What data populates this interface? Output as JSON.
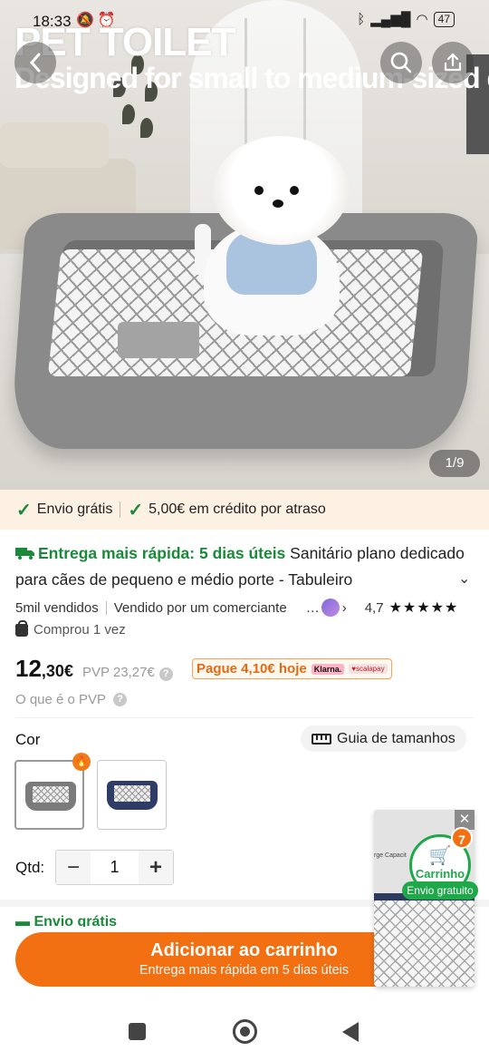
{
  "status_bar": {
    "time": "18:33",
    "battery": "47"
  },
  "hero": {
    "overlay_title": "PET TOILET",
    "overlay_subtitle": "Designed for small to medium-sized dogs",
    "image_counter": "1/9"
  },
  "shipping_banner": {
    "free_shipping": "Envio grátis",
    "delay_credit": "5,00€ em crédito por atraso"
  },
  "product": {
    "fast_delivery": "Entrega mais rápida: 5 dias úteis",
    "title": "Sanitário plano dedicado para cães de pequeno e médio porte - Tabuleiro",
    "sold_count": "5mil vendidos",
    "seller": "Vendido por um comerciante",
    "rating": "4,7",
    "rating_stars": 4.7,
    "bought": "Comprou 1 vez",
    "price_int": "12",
    "price_dec": ",30€",
    "pvp": "PVP 23,27€",
    "pay_today": "Pague 4,10€ hoje",
    "klarna": "Klarna.",
    "scalapay": "♥scalapay",
    "pvp_help": "O que é o PVP"
  },
  "options": {
    "color_label": "Cor",
    "size_guide": "Guia de tamanhos",
    "swatches": [
      {
        "color": "#7b7b7b",
        "selected": true
      },
      {
        "color": "#2f3d66",
        "selected": false
      }
    ],
    "qty_label": "Qtd:",
    "qty_value": "1"
  },
  "peek_text": "Envio grátis",
  "cta": {
    "main": "Adicionar ao carrinho",
    "sub": "Entrega mais rápida em 5 dias úteis"
  },
  "floating_cart": {
    "label": "Carrinho",
    "count": "7",
    "free_shipping": "Envio gratuito",
    "video_text": "rge Capacit"
  },
  "colors": {
    "accent": "#f26f12",
    "green": "#1a8a3a",
    "banner_bg": "#fdf1e3"
  }
}
